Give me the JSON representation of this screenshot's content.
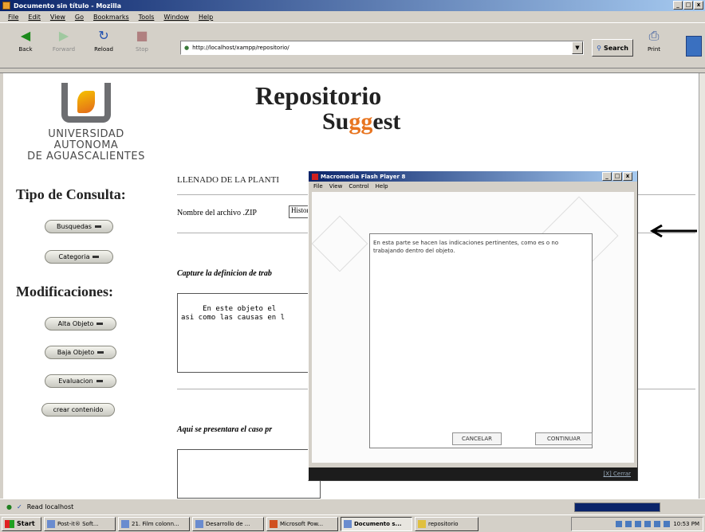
{
  "window": {
    "title": "Documento sin título - Mozilla",
    "controls": [
      "_",
      "□",
      "x"
    ]
  },
  "menu": [
    "File",
    "Edit",
    "View",
    "Go",
    "Bookmarks",
    "Tools",
    "Window",
    "Help"
  ],
  "toolbar": {
    "back": "Back",
    "forward": "Forward",
    "reload": "Reload",
    "stop": "Stop",
    "url": "http://localhost/xampp/repositorio/",
    "search": "Search",
    "print": "Print"
  },
  "logo": {
    "line1": "UNIVERSIDAD AUTONOMA",
    "line2": "DE AGUASCALIENTES"
  },
  "brand": {
    "repo": "Repositorio",
    "sug_a": "Su",
    "sug_b": "gg",
    "sug_c": "est"
  },
  "left": {
    "consulta_head": "Tipo de Consulta:",
    "busquedas": "Busquedas",
    "categoria": "Categoria",
    "modif_head": "Modificaciones:",
    "alta": "Alta Objeto",
    "baja": "Baja Objeto",
    "evaluacion": "Evaluacion",
    "crear": "crear contenido"
  },
  "main": {
    "section_title": "LLENADO DE LA PLANTI",
    "zip_label": "Nombre del archivo .ZIP",
    "zip_value": "Histor",
    "capture_label": "Capture la definicion de trab",
    "capture_text": "     En este objeto el\nasi como las causas en l",
    "case_label": "Aqui se presentara el caso pr"
  },
  "flash": {
    "title": "Macromedia Flash Player 8",
    "menu": [
      "File",
      "View",
      "Control",
      "Help"
    ],
    "body": "En esta parte se hacen las indicaciones pertinentes, como es o no trabajando dentro del objeto.",
    "cancel": "CANCELAR",
    "continue": "CONTINUAR",
    "footer": "[X] Cerrar"
  },
  "status": {
    "text": "Read localhost"
  },
  "taskbar": {
    "start": "Start",
    "tasks": [
      "Post-it® Soft...",
      "21. Film colonn...",
      "Desarrollo de ...",
      "Microsoft Pow...",
      "Documento s...",
      "repositorio"
    ],
    "clock": "10:53 PM"
  }
}
